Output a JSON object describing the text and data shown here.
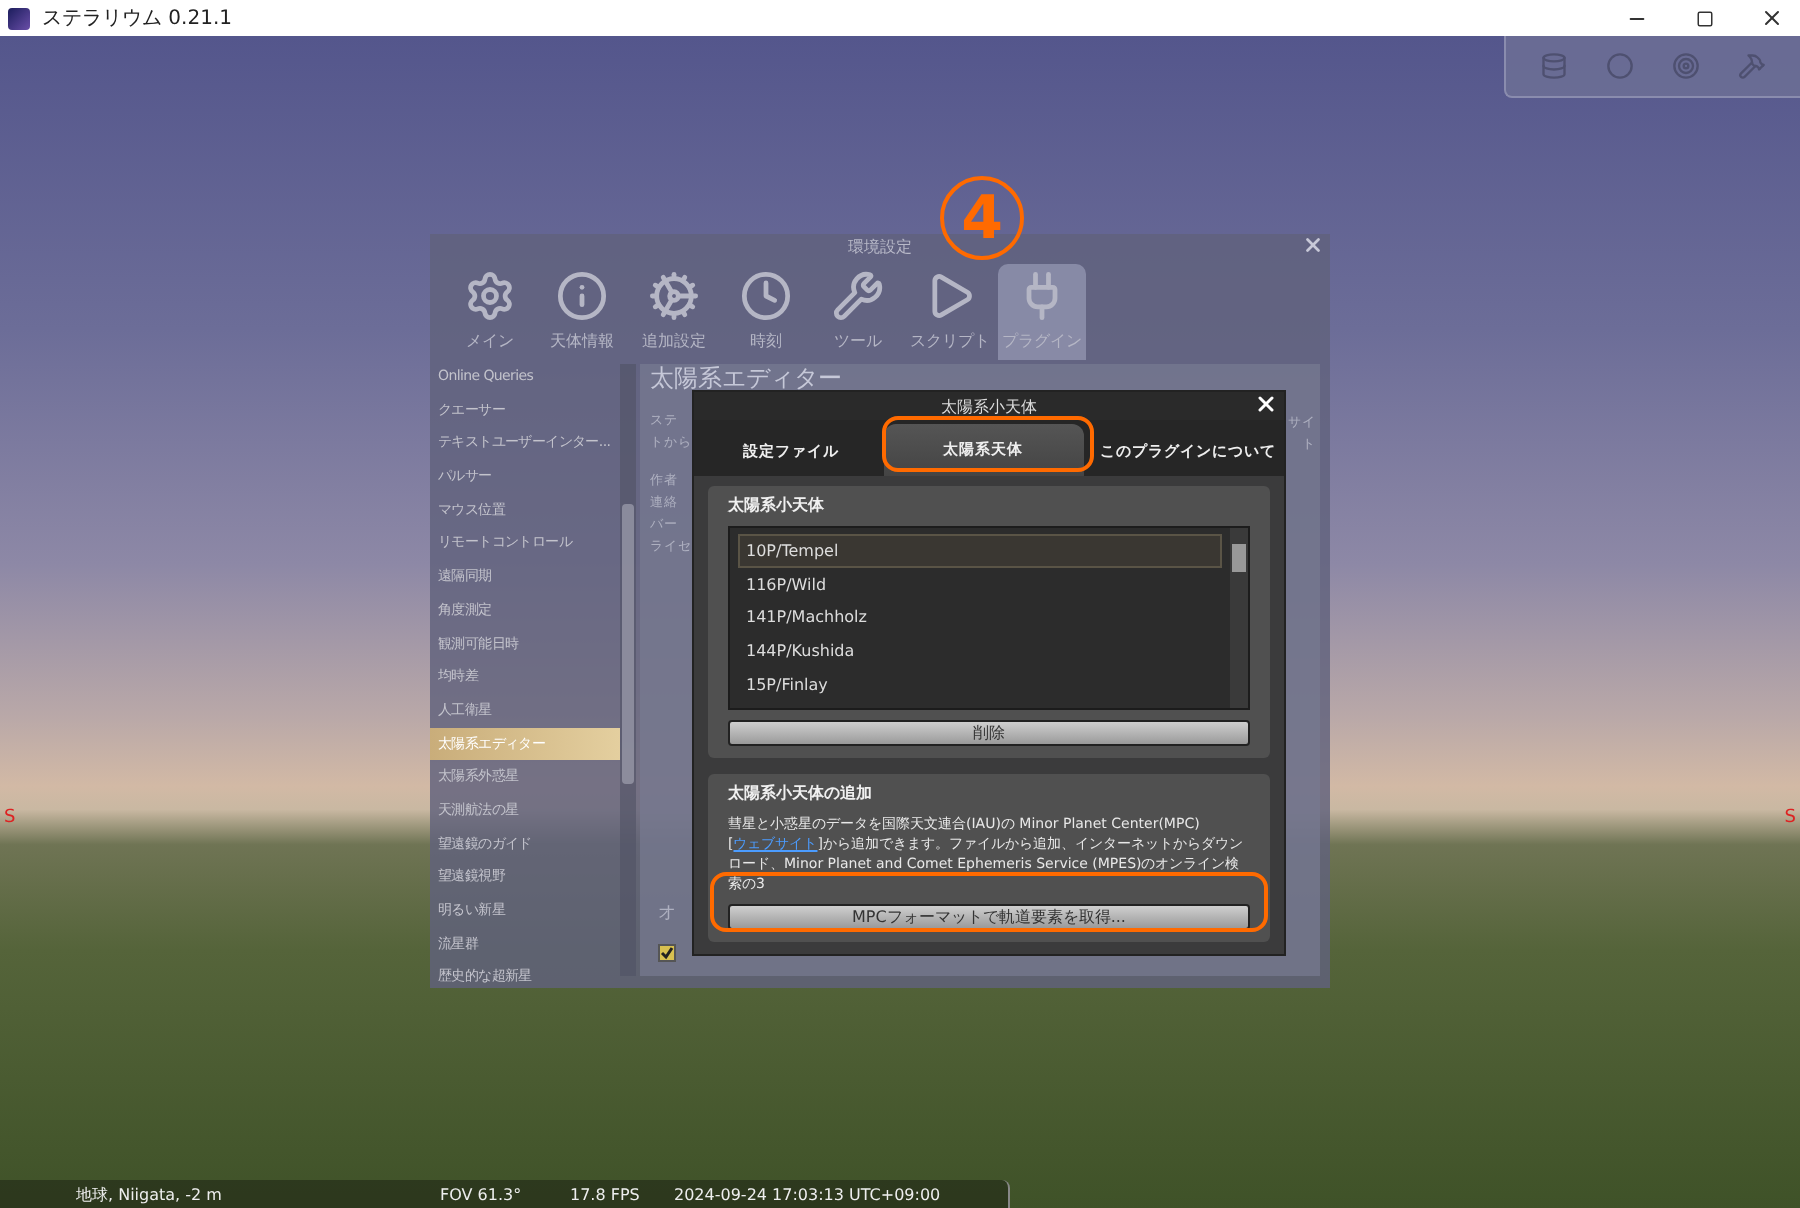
{
  "window": {
    "title": "ステラリウム 0.21.1"
  },
  "cardinal_marks": [
    "S",
    "S"
  ],
  "config_dialog": {
    "title": "環境設定",
    "tabs": [
      {
        "label": "メイン",
        "selected": false
      },
      {
        "label": "天体情報",
        "selected": false
      },
      {
        "label": "追加設定",
        "selected": false
      },
      {
        "label": "時刻",
        "selected": false
      },
      {
        "label": "ツール",
        "selected": false
      },
      {
        "label": "スクリプト",
        "selected": false
      },
      {
        "label": "プラグイン",
        "selected": true
      }
    ],
    "plugins": [
      {
        "label": "Online Queries",
        "selected": false
      },
      {
        "label": "クエーサー",
        "selected": false
      },
      {
        "label": "テキストユーザーインター...",
        "selected": false
      },
      {
        "label": "パルサー",
        "selected": false
      },
      {
        "label": "マウス位置",
        "selected": false
      },
      {
        "label": "リモートコントロール",
        "selected": false
      },
      {
        "label": "遠隔同期",
        "selected": false
      },
      {
        "label": "角度測定",
        "selected": false
      },
      {
        "label": "観測可能日時",
        "selected": false
      },
      {
        "label": "均時差",
        "selected": false
      },
      {
        "label": "人工衛星",
        "selected": false
      },
      {
        "label": "太陽系エディター",
        "selected": true
      },
      {
        "label": "太陽系外惑星",
        "selected": false
      },
      {
        "label": "天測航法の星",
        "selected": false
      },
      {
        "label": "望遠鏡のガイド",
        "selected": false
      },
      {
        "label": "望遠鏡視野",
        "selected": false
      },
      {
        "label": "明るい新星",
        "selected": false
      },
      {
        "label": "流星群",
        "selected": false
      },
      {
        "label": "歴史的な超新星",
        "selected": false
      }
    ],
    "heading": "太陽系エディター",
    "fragments_left": [
      "ステ",
      "トから",
      "作者",
      "連絡",
      "バー",
      "ライセ"
    ],
    "fragments_right": [
      "サイ",
      "ト"
    ],
    "option_label": "オ",
    "checkbox": {
      "checked": true
    }
  },
  "editor_dialog": {
    "title": "太陽系小天体",
    "tabs": [
      {
        "label": "設定ファイル",
        "selected": false
      },
      {
        "label": "太陽系天体",
        "selected": true
      },
      {
        "label": "このプラグインについて",
        "selected": false
      }
    ],
    "list_group": {
      "title": "太陽系小天体",
      "items": [
        {
          "label": "10P/Tempel",
          "selected": true
        },
        {
          "label": "116P/Wild",
          "selected": false
        },
        {
          "label": "141P/Machholz",
          "selected": false
        },
        {
          "label": "144P/Kushida",
          "selected": false
        },
        {
          "label": "15P/Finlay",
          "selected": false
        }
      ],
      "button": "削除"
    },
    "add_group": {
      "title": "太陽系小天体の追加",
      "text_before": "彗星と小惑星のデータを国際天文連合(IAU)の Minor Planet Center(MPC) [",
      "link": "ウェブサイト",
      "text_after": "]から追加できます。ファイルから追加、インターネットからダウンロード、Minor Planet and Comet Ephemeris Service (MPES)のオンライン検索の3",
      "button": "MPCフォーマットで軌道要素を取得..."
    }
  },
  "annotation": {
    "step": "4"
  },
  "status_bar": {
    "location": "地球, Niigata, -2 m",
    "fov": "FOV 61.3°",
    "fps": "17.8 FPS",
    "datetime": "2024-09-24 17:03:13 UTC+09:00"
  }
}
